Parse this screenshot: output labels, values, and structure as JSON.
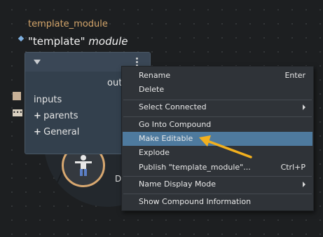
{
  "node": {
    "title": "template_module",
    "name_quoted": "\"template\"",
    "name_rest": " module",
    "output_label": "out",
    "rows": [
      "inputs",
      "parents",
      "General"
    ],
    "side_dots_label": "•••"
  },
  "wheel": {
    "letter": "D"
  },
  "context_menu": {
    "items": [
      {
        "label": "Rename",
        "shortcut": "Enter"
      },
      {
        "label": "Delete",
        "shortcut": ""
      },
      {
        "label": "Select Connected",
        "shortcut": ""
      },
      {
        "label": "Go Into Compound",
        "shortcut": ""
      },
      {
        "label": "Make Editable",
        "shortcut": ""
      },
      {
        "label": "Explode",
        "shortcut": ""
      },
      {
        "label": "Publish \"template_module\"...",
        "shortcut": "Ctrl+P"
      },
      {
        "label": "Name Display Mode",
        "shortcut": ""
      },
      {
        "label": "Show Compound Information",
        "shortcut": ""
      }
    ],
    "highlighted": "Make Editable"
  },
  "annotation": {
    "arrow_color": "#f2b01e"
  },
  "colors": {
    "highlight": "#4e7a9e",
    "title": "#d4a56a",
    "ring": "#d8a870"
  }
}
